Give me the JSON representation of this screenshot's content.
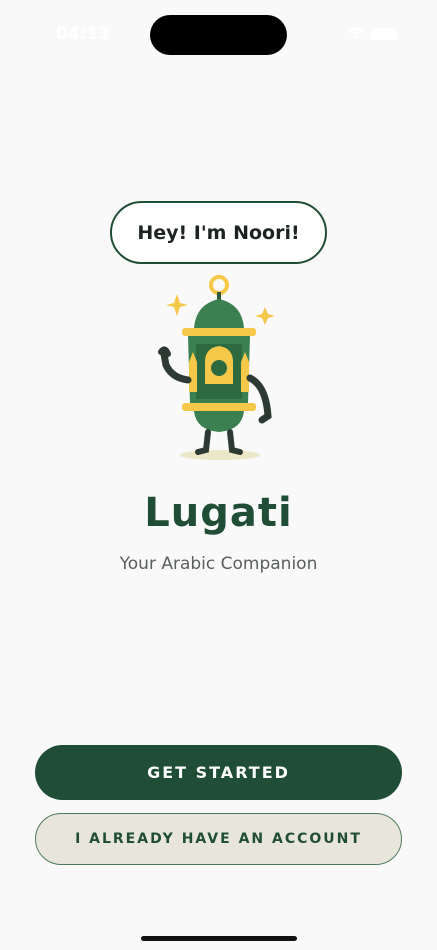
{
  "status_bar": {
    "time": "04:13"
  },
  "mascot": {
    "speech": "Hey! I'm Noori!",
    "icon": "lantern-mascot"
  },
  "app": {
    "title": "Lugati",
    "subtitle": "Your Arabic Companion"
  },
  "actions": {
    "primary": "GET STARTED",
    "secondary": "I ALREADY HAVE AN ACCOUNT"
  },
  "colors": {
    "brand_green": "#1f4d35",
    "accent_yellow": "#f5c84a",
    "secondary_bg": "#e8e6da"
  }
}
